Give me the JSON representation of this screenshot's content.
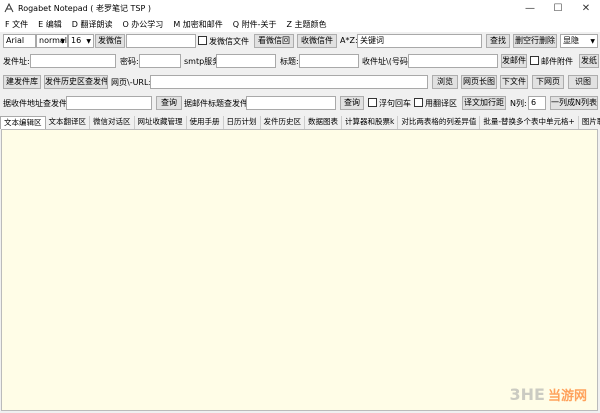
{
  "window": {
    "title": "Rogabet Notepad ( 老罗笔记 TSP )",
    "minimize": "—",
    "maximize": "☐",
    "close": "✕"
  },
  "menu": [
    "F 文件",
    "E 编辑",
    "D 翻译朗读",
    "O 办公学习",
    "M 加密和邮件",
    "Q 附件-关于",
    "Z 主题颜色"
  ],
  "toolbar1": {
    "font": "Arial",
    "style": "normal",
    "size": "16",
    "send_wechat": "发微信",
    "wechat_value": "",
    "send_wechat_file_label": "发微信文件",
    "view_wechat_back": "看微信回",
    "receive_wechat": "收微信件",
    "keyword_label": "A*Z:",
    "keyword_value": "关键词",
    "find": "查找",
    "delete_blank": "删空行删除",
    "hide": "显隐"
  },
  "toolbar2": {
    "sender_label": "发件址:",
    "sender_value": "",
    "password_label": "密码:",
    "password_value": "",
    "smtp_label": "smtp服务",
    "smtp_value": "",
    "subject_label": "标题:",
    "subject_value": "",
    "recipient_label": "收件址\\(号码):",
    "recipient_value": "",
    "send_mail": "发邮件",
    "mail_attach_label": "邮件附件",
    "send_other": "发纸"
  },
  "toolbar3": {
    "create_mailbox": "建发件库",
    "send_history": "发件历史区查发件",
    "url_label": "网页\\-URL:",
    "url_value": "",
    "browse": "浏览",
    "long_image": "网页长图",
    "download_file": "下文件",
    "download_page": "下网页",
    "recognize": "识图"
  },
  "toolbar4": {
    "recv_addr_label": "据收件地址查发件:",
    "recv_addr_value": "",
    "query1": "查询",
    "subject_query_label": "据邮件标题查发件:",
    "subject_query_value": "",
    "query2": "查询",
    "cmd_enter_label": "浮句回车",
    "translate_area_label": "用翻译区",
    "translate_exec": "译文加行距",
    "n_label": "N列:",
    "n_value": "6",
    "n_split": "一列成N列表"
  },
  "tabs": [
    "文本编辑区",
    "文本翻译区",
    "微信对话区",
    "网址收藏管理",
    "使用手册",
    "日历计划",
    "发件历史区",
    "数据图表",
    "计算器和股票k",
    "对比两表格的列差异值",
    "批量-替换多个表中单元格+",
    "图片取文本"
  ],
  "editor_text": "",
  "watermark": {
    "logo": "3HE",
    "site": "当游网"
  }
}
